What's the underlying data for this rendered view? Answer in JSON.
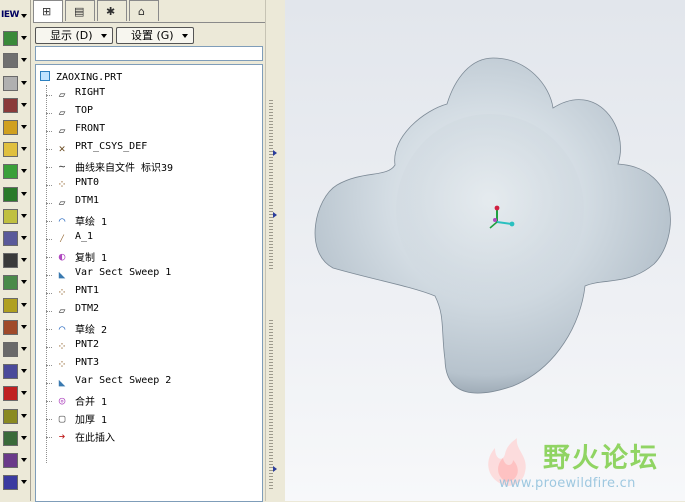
{
  "toolbar": {
    "items": [
      {
        "icon": "view-icon",
        "label": "IEW"
      },
      {
        "icon": "datum-plane-icon"
      },
      {
        "icon": "datum-axis-icon"
      },
      {
        "icon": "datum-curve-icon"
      },
      {
        "icon": "datum-point-icon"
      },
      {
        "icon": "sketch-tool-icon"
      },
      {
        "icon": "pencil-icon"
      },
      {
        "icon": "extrude-icon"
      },
      {
        "icon": "revolve-icon"
      },
      {
        "icon": "sweep-icon"
      },
      {
        "icon": "blend-icon"
      },
      {
        "icon": "shell-icon"
      },
      {
        "icon": "rib-icon"
      },
      {
        "icon": "draft-icon"
      },
      {
        "icon": "round-icon"
      },
      {
        "icon": "chamfer-icon"
      },
      {
        "icon": "pattern-icon"
      },
      {
        "icon": "mirror-icon"
      },
      {
        "icon": "merge-icon"
      },
      {
        "icon": "trim-icon"
      },
      {
        "icon": "offset-icon"
      },
      {
        "icon": "thicken-icon"
      }
    ]
  },
  "tabs": [
    {
      "name": "model-tree-tab",
      "icon": "tree-icon",
      "glyph": "⊞"
    },
    {
      "name": "folder-browser-tab",
      "icon": "folder-icon",
      "glyph": "▤"
    },
    {
      "name": "favorites-tab",
      "icon": "favorites-icon",
      "glyph": "✱"
    },
    {
      "name": "connections-tab",
      "icon": "connections-icon",
      "glyph": "⌂"
    }
  ],
  "panel": {
    "show_button": "显示 (D)",
    "settings_button": "设置 (G)"
  },
  "tree": {
    "root": "ZAOXING.PRT",
    "items": [
      {
        "label": "RIGHT",
        "icon": "datum-plane-icon",
        "glyph": "▱",
        "color": "#333333"
      },
      {
        "label": "TOP",
        "icon": "datum-plane-icon",
        "glyph": "▱",
        "color": "#333333"
      },
      {
        "label": "FRONT",
        "icon": "datum-plane-icon",
        "glyph": "▱",
        "color": "#333333"
      },
      {
        "label": "PRT_CSYS_DEF",
        "icon": "coordinate-system-icon",
        "glyph": "✕",
        "color": "#6a4a20"
      },
      {
        "label": "曲线来自文件 标识39",
        "icon": "curve-icon",
        "glyph": "∼",
        "color": "#333333"
      },
      {
        "label": "PNT0",
        "icon": "datum-point-icon",
        "glyph": "⁘",
        "color": "#8a5a20"
      },
      {
        "label": "DTM1",
        "icon": "datum-plane-icon",
        "glyph": "▱",
        "color": "#333333"
      },
      {
        "label": "草绘 1",
        "icon": "sketch-icon",
        "glyph": "⌒",
        "color": "#2a6ac0"
      },
      {
        "label": "A_1",
        "icon": "datum-axis-icon",
        "glyph": "⁄",
        "color": "#8a5a20"
      },
      {
        "label": "复制 1",
        "icon": "copy-surface-icon",
        "glyph": "◐",
        "color": "#b04ac0"
      },
      {
        "label": "Var Sect Sweep 1",
        "icon": "sweep-icon",
        "glyph": "◣",
        "color": "#3a7ab0"
      },
      {
        "label": "PNT1",
        "icon": "datum-point-icon",
        "glyph": "⁘",
        "color": "#8a5a20"
      },
      {
        "label": "DTM2",
        "icon": "datum-plane-icon",
        "glyph": "▱",
        "color": "#333333"
      },
      {
        "label": "草绘 2",
        "icon": "sketch-icon",
        "glyph": "⌒",
        "color": "#2a6ac0"
      },
      {
        "label": "PNT2",
        "icon": "datum-point-icon",
        "glyph": "⁘",
        "color": "#8a5a20"
      },
      {
        "label": "PNT3",
        "icon": "datum-point-icon",
        "glyph": "⁘",
        "color": "#8a5a20"
      },
      {
        "label": "Var Sect Sweep 2",
        "icon": "sweep-icon",
        "glyph": "◣",
        "color": "#3a7ab0"
      },
      {
        "label": "合并 1",
        "icon": "merge-icon",
        "glyph": "◎",
        "color": "#b04ac0"
      },
      {
        "label": "加厚 1",
        "icon": "thicken-icon",
        "glyph": "▢",
        "color": "#555555"
      },
      {
        "label": "在此插入",
        "icon": "insert-here-arrow-icon",
        "glyph": "➔",
        "color": "#c02020"
      }
    ]
  },
  "watermark": {
    "title": "野火论坛",
    "url": "www.proewildfire.cn"
  },
  "colors": {
    "surface": "#c9d3dc",
    "csys_x": "#2ac0c0",
    "csys_y": "#d02040",
    "csys_z": "#20a040",
    "watermark": "#7fcf4a"
  }
}
